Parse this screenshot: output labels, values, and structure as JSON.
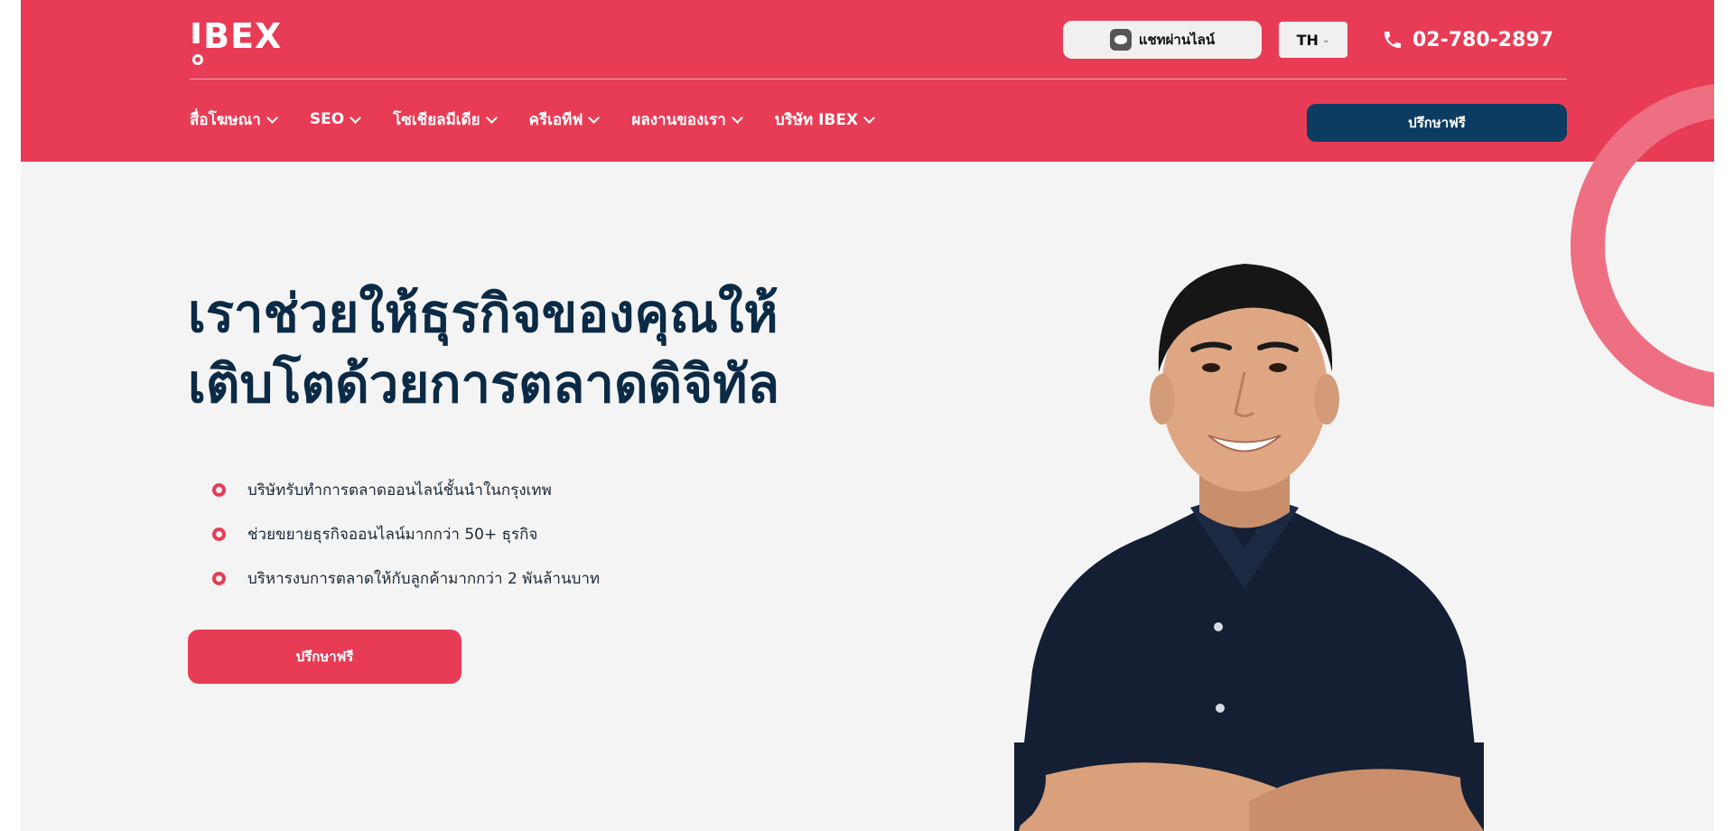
{
  "header": {
    "logo_text": "IBEX",
    "chat_button_label": "แชทผ่านไลน์",
    "language": "TH",
    "phone": "02-780-2897",
    "nav": [
      {
        "label": "สื่อโฆษณา"
      },
      {
        "label": "SEO"
      },
      {
        "label": "โซเชียลมีเดีย"
      },
      {
        "label": "ครีเอทีฟ"
      },
      {
        "label": "ผลงานของเรา"
      },
      {
        "label": "บริษัท IBEX"
      }
    ],
    "cta_label": "ปรึกษาฟรี"
  },
  "hero": {
    "headline_line1": "เราช่วยให้ธุรกิจของคุณให้",
    "headline_line2": "เติบโตด้วยการตลาดดิจิทัล",
    "features": [
      "บริษัทรับทำการตลาดออนไลน์ชั้นนำในกรุงเทพ",
      "ช่วยขยายธุรกิจออนไลน์มากกว่า 50+ ธุรกิจ",
      "บริหารงบการตลาดให้กับลูกค้ามากกว่า 2 พันล้านบาท"
    ],
    "cta_label": "ปรึกษาฟรี"
  },
  "colors": {
    "brand_red": "#e83c56",
    "navy": "#0c3c61",
    "headline": "#0b2a45",
    "background": "#f4f4f4",
    "ring_pink": "#ee6f82"
  },
  "icons": [
    "line-icon",
    "phone-icon",
    "chevron-down-icon",
    "bullet-ring-icon"
  ]
}
